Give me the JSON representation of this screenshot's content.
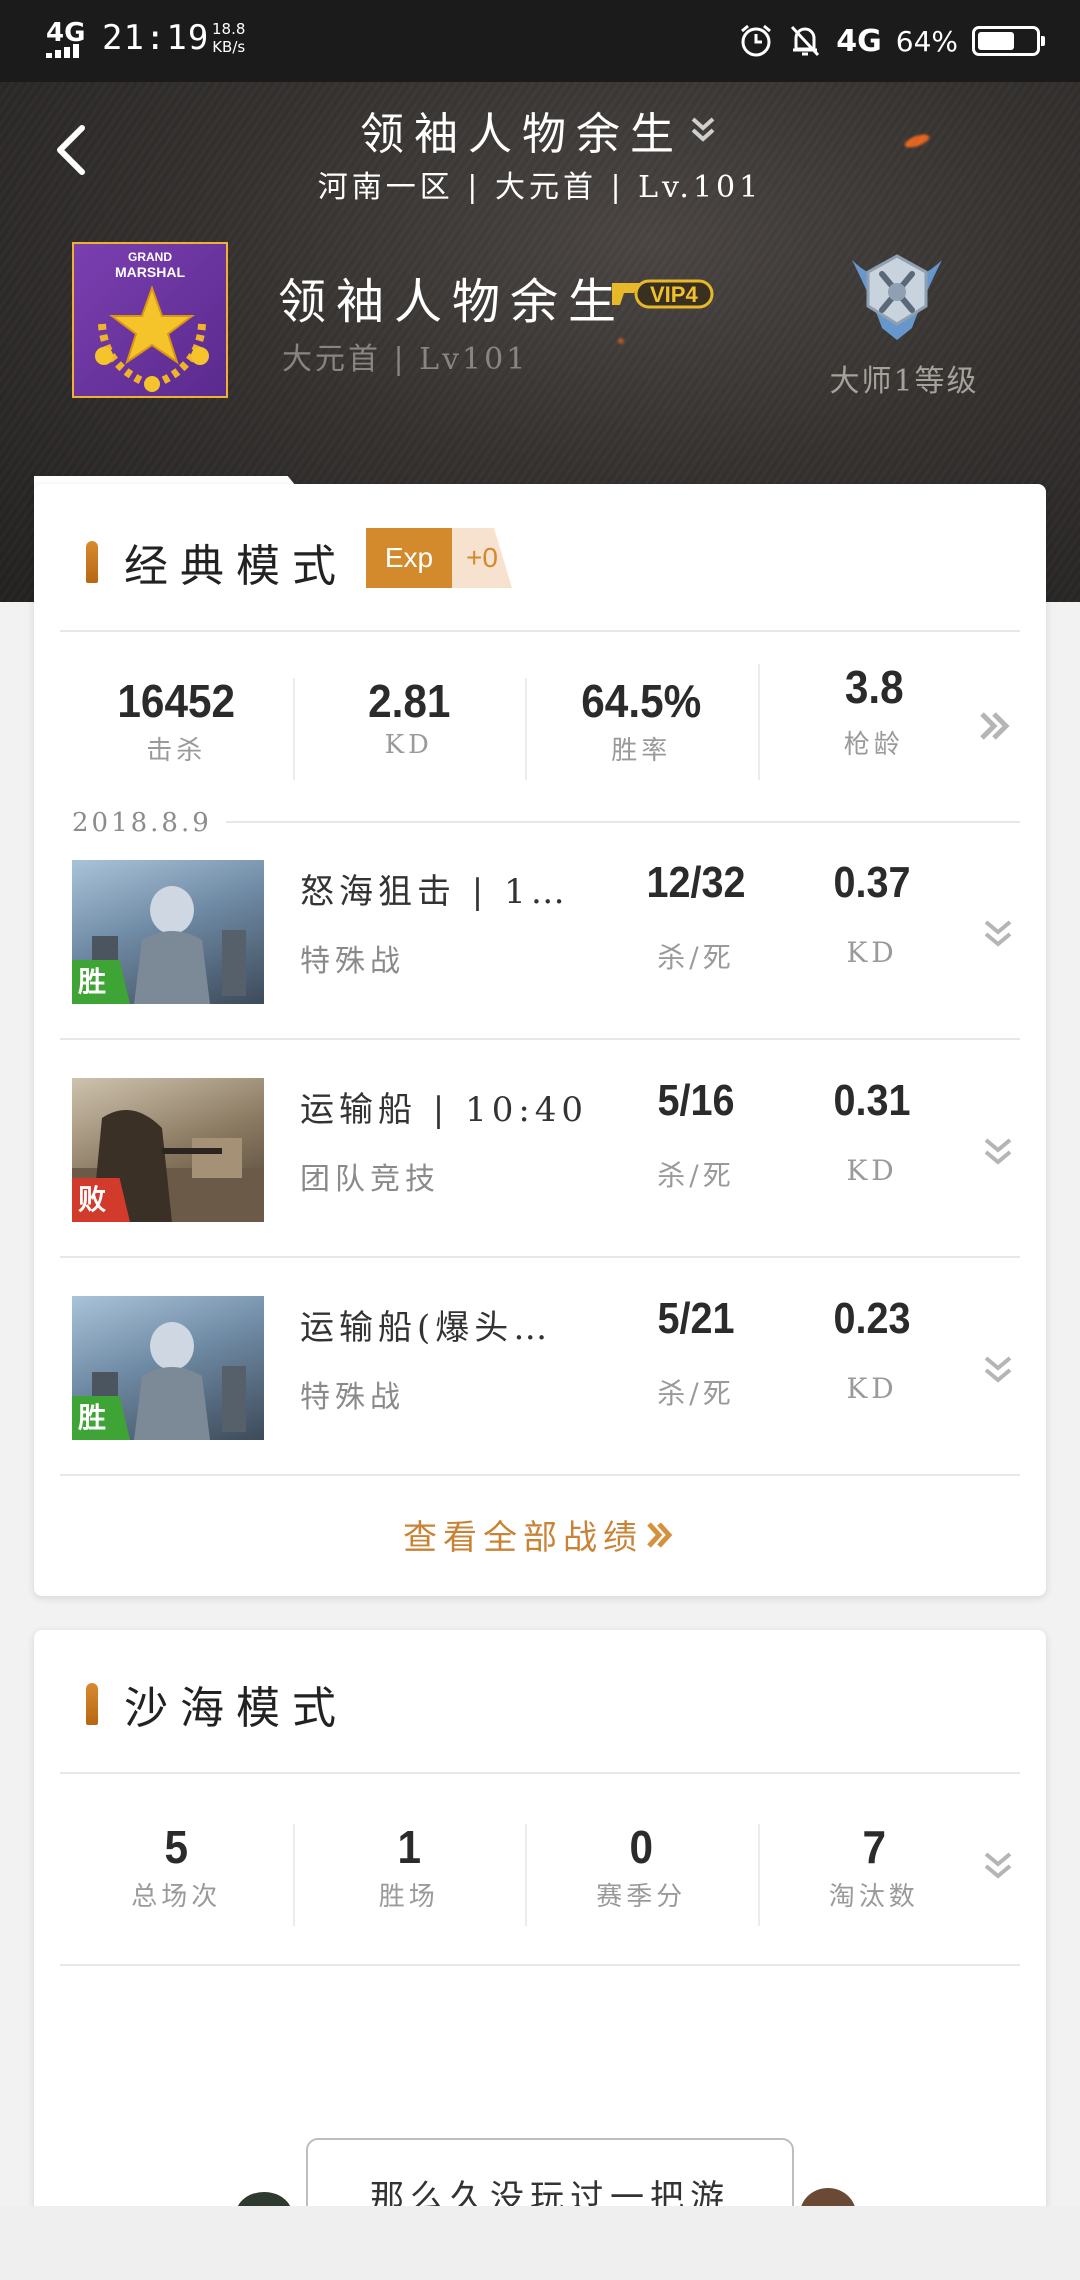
{
  "status_bar": {
    "network": "4G",
    "time": "21:19",
    "speed_value": "18.8",
    "speed_unit": "KB/s",
    "network_right": "4G",
    "battery_percent": "64%",
    "battery_level": 0.64
  },
  "header": {
    "title": "领袖人物余生",
    "subtitle": "河南一区 | 大元首 | Lv.101"
  },
  "profile": {
    "avatar_line1": "GRAND",
    "avatar_line2": "MARSHAL",
    "name": "领袖人物余生",
    "vip": "VIP4",
    "rank_level": "大元首 | Lv101",
    "tier": "大师1等级"
  },
  "classic_mode": {
    "title": "经典模式",
    "exp_label": "Exp",
    "exp_value": "+0",
    "stats": [
      {
        "value": "16452",
        "label": "击杀"
      },
      {
        "value": "2.81",
        "label": "KD"
      },
      {
        "value": "64.5%",
        "label": "胜率"
      },
      {
        "value": "3.8",
        "label": "枪龄"
      }
    ],
    "date": "2018.8.9",
    "matches": [
      {
        "result": "胜",
        "title": "怒海狙击 | 1…",
        "type": "特殊战",
        "score": "12/32",
        "score_label": "杀/死",
        "kd": "0.37",
        "kd_label": "KD"
      },
      {
        "result": "败",
        "title": "运输船 | 10:40",
        "type": "团队竞技",
        "score": "5/16",
        "score_label": "杀/死",
        "kd": "0.31",
        "kd_label": "KD"
      },
      {
        "result": "胜",
        "title": "运输船(爆头…",
        "type": "特殊战",
        "score": "5/21",
        "score_label": "杀/死",
        "kd": "0.23",
        "kd_label": "KD"
      }
    ],
    "view_all": "查看全部战绩"
  },
  "desert_mode": {
    "title": "沙海模式",
    "stats": [
      {
        "value": "5",
        "label": "总场次"
      },
      {
        "value": "1",
        "label": "胜场"
      },
      {
        "value": "0",
        "label": "赛季分"
      },
      {
        "value": "7",
        "label": "淘汰数"
      }
    ]
  },
  "chat": {
    "text": "那么久没玩过一把游"
  },
  "colors": {
    "accent": "#c98336",
    "win": "#3ea436",
    "lose": "#d23a2b",
    "avatar_bg": "#6a34a0"
  }
}
